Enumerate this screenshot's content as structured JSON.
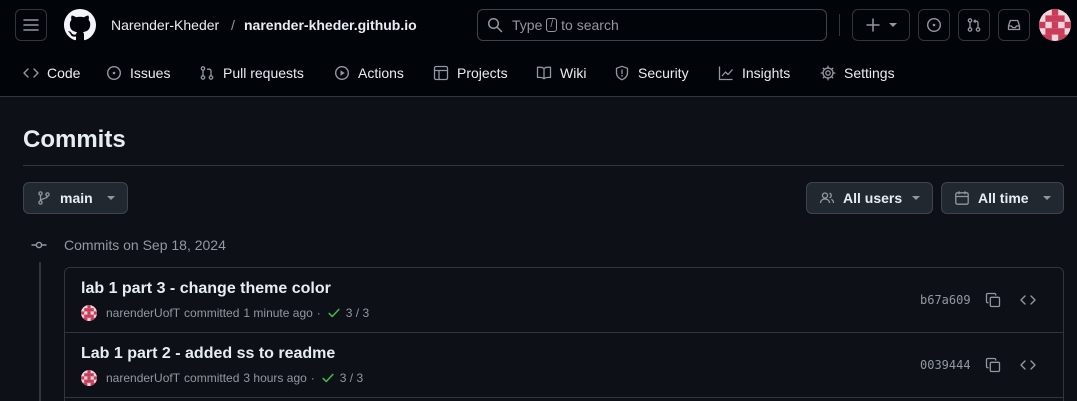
{
  "header": {
    "owner": "Narender-Kheder",
    "separator": "/",
    "repo": "narender-kheder.github.io",
    "search": {
      "prefix": "Type",
      "key": "/",
      "suffix": "to search"
    }
  },
  "nav": {
    "code": "Code",
    "issues": "Issues",
    "pulls": "Pull requests",
    "actions": "Actions",
    "projects": "Projects",
    "wiki": "Wiki",
    "security": "Security",
    "insights": "Insights",
    "settings": "Settings"
  },
  "page": {
    "title": "Commits",
    "branch": "main",
    "users_filter": "All users",
    "time_filter": "All time"
  },
  "group": {
    "label": "Commits on Sep 18, 2024"
  },
  "commits": [
    {
      "message": "lab 1 part 3 - change theme color",
      "author": "narenderUofT",
      "action": "committed",
      "time": "1 minute ago",
      "dot": "·",
      "checks": "3 / 3",
      "sha": "b67a609"
    },
    {
      "message": "Lab 1 part 2 - added ss to readme",
      "author": "narenderUofT",
      "action": "committed",
      "time": "3 hours ago",
      "dot": "·",
      "checks": "3 / 3",
      "sha": "0039444"
    }
  ],
  "colors": {
    "success": "#3fb950",
    "accent": "#e6edf3",
    "avatar": "#c93c5a"
  }
}
